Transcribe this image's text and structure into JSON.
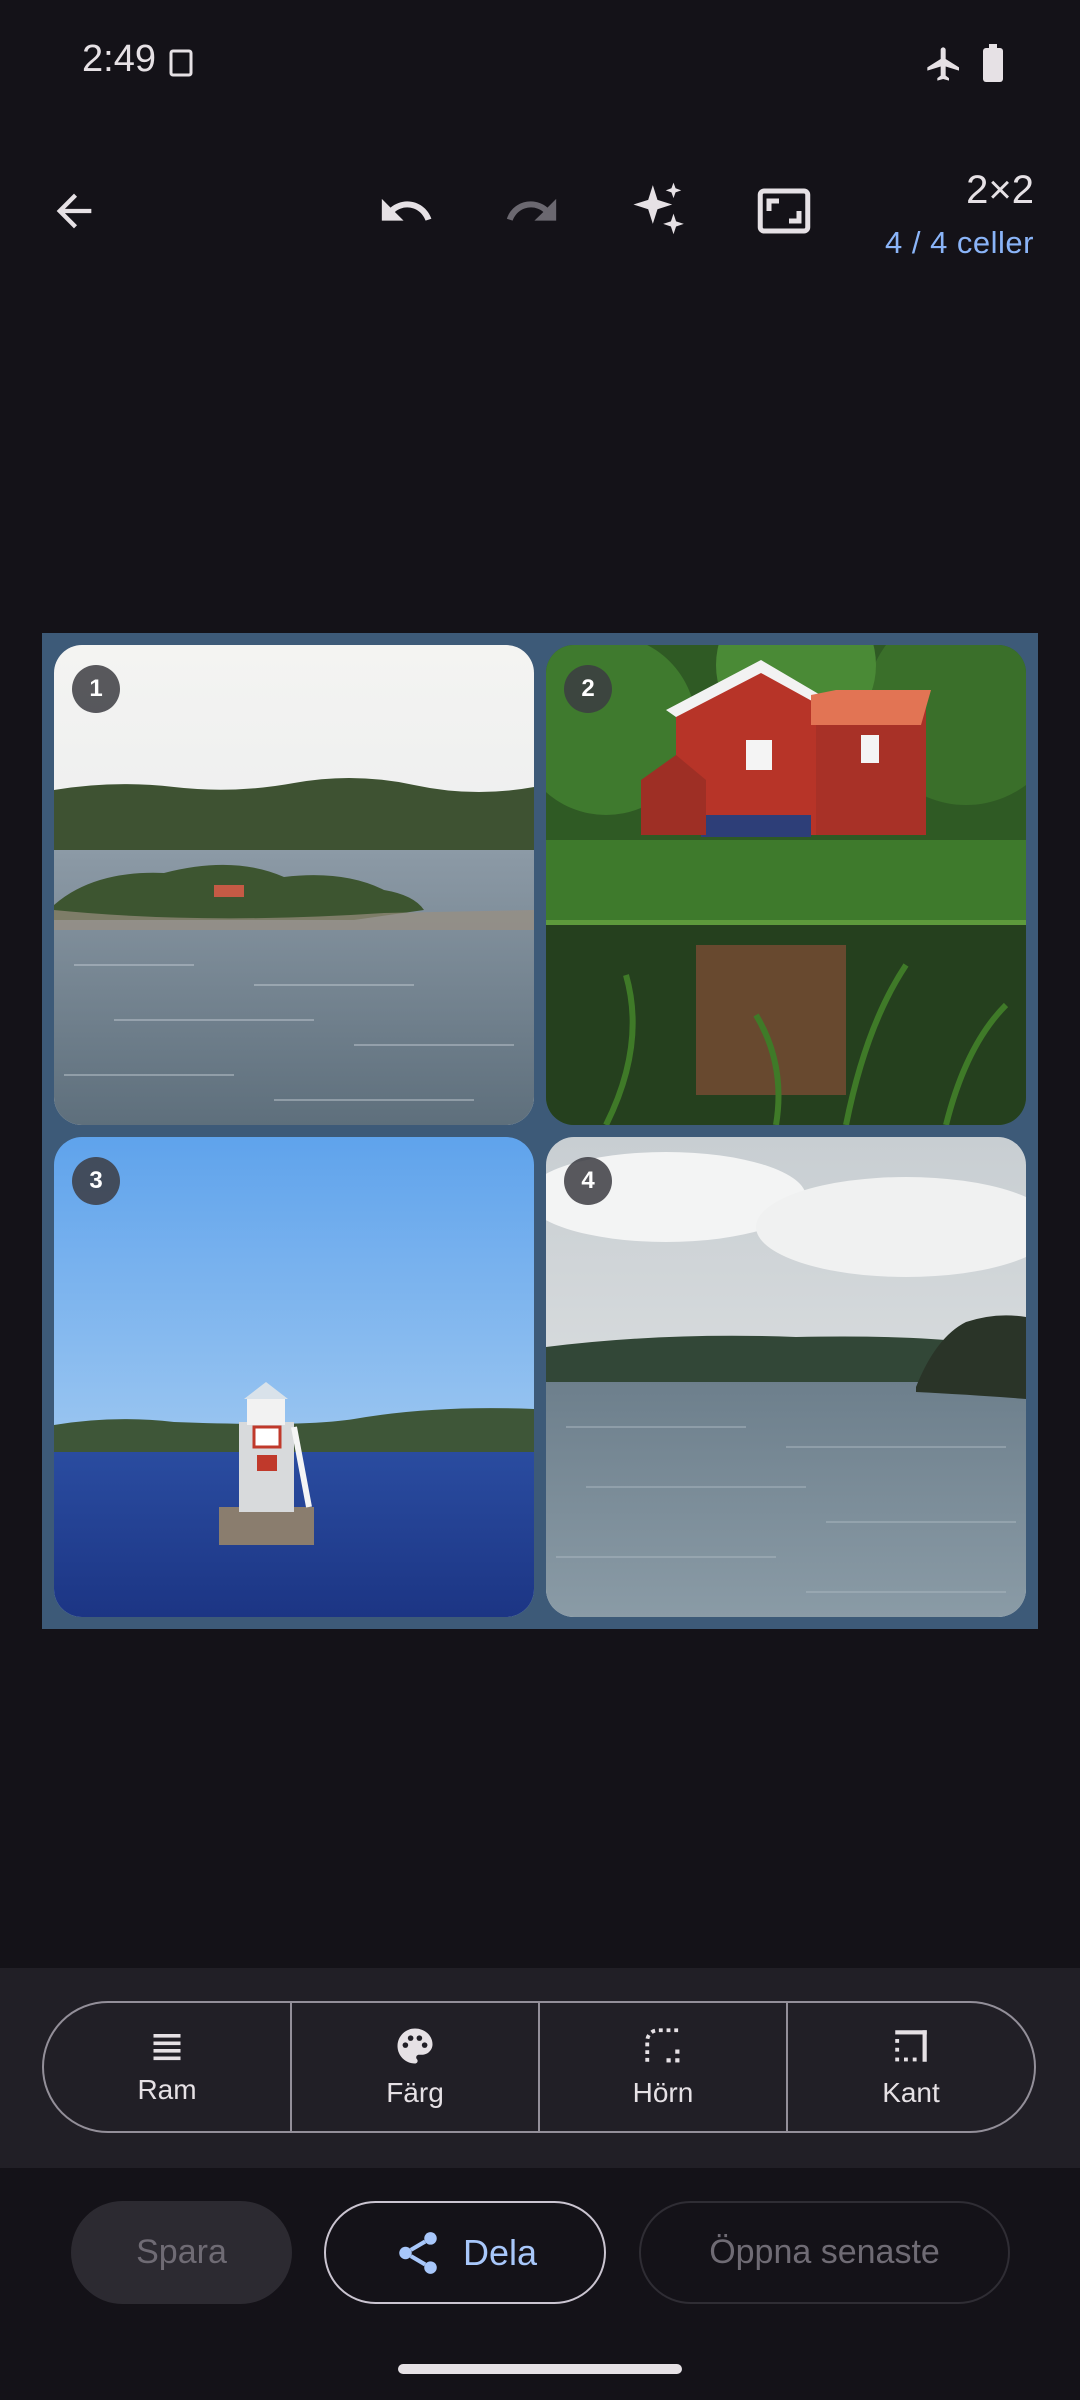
{
  "status_bar": {
    "time": "2:49",
    "icons": [
      "sim-card-icon",
      "airplane-icon",
      "battery-icon"
    ]
  },
  "toolbar": {
    "icons": [
      "back-arrow-icon",
      "undo-icon",
      "redo-icon",
      "sparkle-icon",
      "aspect-frame-icon"
    ],
    "redo_enabled": false,
    "grid_size": "2×2",
    "cell_count": "4 / 4 celler"
  },
  "collage": {
    "border_color": "#3d5a78",
    "cells": [
      {
        "number": "1",
        "scene": "island-landscape"
      },
      {
        "number": "2",
        "scene": "red-house-by-lake"
      },
      {
        "number": "3",
        "scene": "lighthouse-at-sea"
      },
      {
        "number": "4",
        "scene": "cloudy-lake"
      }
    ]
  },
  "tool_panel": {
    "items": [
      {
        "label": "Ram",
        "icon": "lines-icon"
      },
      {
        "label": "Färg",
        "icon": "palette-icon"
      },
      {
        "label": "Hörn",
        "icon": "corner-icon"
      },
      {
        "label": "Kant",
        "icon": "edge-icon"
      }
    ]
  },
  "actions": {
    "save_label": "Spara",
    "share_label": "Dela",
    "open_recent_label": "Öppna senaste"
  },
  "colors": {
    "accent": "#8ab4f8",
    "share_text": "#a8c7fa",
    "background": "#141218"
  }
}
